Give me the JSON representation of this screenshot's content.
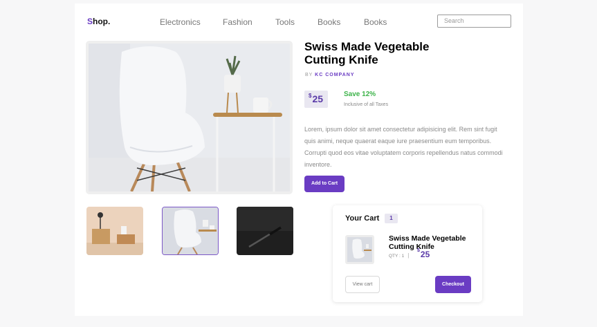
{
  "header": {
    "logo_initial": "S",
    "logo_rest": "hop.",
    "nav": [
      "Electronics",
      "Fashion",
      "Tools",
      "Books",
      "Books"
    ],
    "search_placeholder": "Search"
  },
  "product": {
    "title": "Swiss Made Vegetable Cutting Knife",
    "by_label": "BY",
    "company": "KC COMPANY",
    "currency": "$",
    "price": "25",
    "save": "Save 12%",
    "tax_note": "Inclusive of all Taxes",
    "description": "Lorem, ipsum dolor sit amet consectetur adipisicing elit. Rem sint fugit quis animi, neque quaerat eaque iure praesentium eum temporibus. Corrupti quod eos vitae voluptatem corporis repellendus natus commodi inventore.",
    "add_label": "Add to Cart"
  },
  "cart": {
    "title": "Your Cart",
    "count": "1",
    "item_name": "Swiss Made Vegetable Cutting Knife",
    "qty_label": "QTY : 1",
    "separator": "|",
    "currency": "$",
    "price": "25",
    "view_label": "View cart",
    "checkout_label": "Checkout"
  },
  "colors": {
    "accent": "#6a3cc3",
    "save_green": "#3db34a"
  }
}
